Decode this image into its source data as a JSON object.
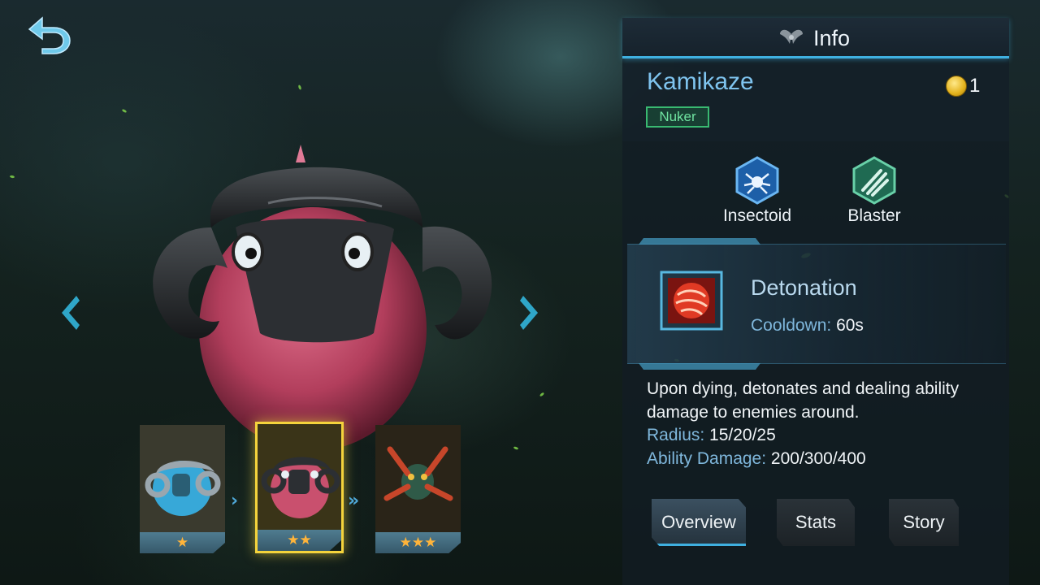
{
  "header": {
    "title": "Info",
    "icon": "wings-icon"
  },
  "hero": {
    "name": "Kamikaze",
    "cost": "1",
    "role": "Nuker"
  },
  "synergies": [
    {
      "label": "Insectoid",
      "icon": "spider-icon",
      "color": "#2b7fd0"
    },
    {
      "label": "Blaster",
      "icon": "claw-icon",
      "color": "#2f9a78"
    }
  ],
  "skill": {
    "name": "Detonation",
    "cooldown_label": "Cooldown:",
    "cooldown_value": "60s",
    "description": "Upon dying, detonates and dealing ability damage to enemies around.",
    "stats": [
      {
        "label": "Radius:",
        "value": "15/20/25"
      },
      {
        "label": "Ability Damage:",
        "value": "200/300/400"
      }
    ]
  },
  "tabs": [
    {
      "label": "Overview",
      "active": true
    },
    {
      "label": "Stats",
      "active": false
    },
    {
      "label": "Story",
      "active": false
    }
  ],
  "evolutions": [
    {
      "stars": "★",
      "selected": false
    },
    {
      "stars": "★★",
      "selected": true
    },
    {
      "stars": "★★★",
      "selected": false
    }
  ],
  "colors": {
    "accent": "#3fb0e0",
    "name": "#7fc4ef",
    "role": "#39b971",
    "star": "#ffb43a",
    "selected": "#f4d33c"
  }
}
